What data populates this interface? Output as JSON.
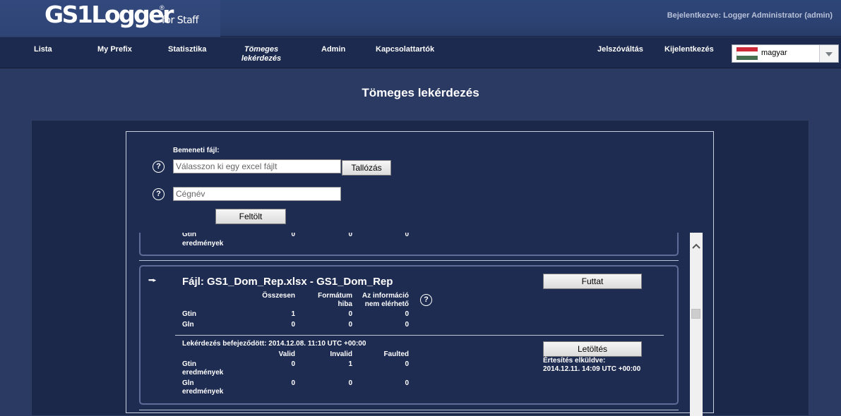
{
  "header": {
    "logo_main": "GS1Logger",
    "logo_reg": "®",
    "logo_sub": "for Staff",
    "logged_in": "Bejelentkezve: Logger Administrator (admin)"
  },
  "nav": {
    "items": [
      {
        "label": "Lista"
      },
      {
        "label": "My Prefix"
      },
      {
        "label": "Statisztika"
      },
      {
        "label": "Tömeges lekérdezés",
        "active": true
      },
      {
        "label": "Admin"
      },
      {
        "label": "Kapcsolattartók"
      }
    ],
    "right_items": [
      {
        "label": "Jelszóváltás"
      },
      {
        "label": "Kijelentkezés"
      }
    ],
    "language": {
      "selected": "magyar",
      "flag_colors": [
        "#ce2939",
        "#ffffff",
        "#477050"
      ]
    }
  },
  "page": {
    "title": "Tömeges lekérdezés"
  },
  "upload_form": {
    "input_label": "Bemeneti fájl:",
    "file_placeholder": "Válasszon ki egy excel fájlt",
    "browse_label": "Tallózás",
    "company_placeholder": "Cégnév",
    "upload_label": "Feltölt",
    "help_symbol": "?"
  },
  "prev_card": {
    "rows": [
      {
        "label_line1": "Gtin",
        "label_line2": "eredmények",
        "values": [
          "0",
          "0",
          "0"
        ]
      }
    ]
  },
  "job_card": {
    "title": "Fájl: GS1_Dom_Rep.xlsx - GS1_Dom_Rep",
    "run_label": "Futtat",
    "columns": [
      {
        "line1": "Összesen",
        "line2": ""
      },
      {
        "line1": "Formátum",
        "line2": "hiba"
      },
      {
        "line1": "Az információ",
        "line2": "nem elérhető"
      }
    ],
    "rows": [
      {
        "label": "Gtin",
        "values": [
          "1",
          "0",
          "0"
        ]
      },
      {
        "label": "Gln",
        "values": [
          "0",
          "0",
          "0"
        ]
      }
    ],
    "finished_text": "Lekérdezés befejeződött: 2014.12.08. 11:10 UTC +00:00",
    "download_label": "Letöltés",
    "notification_label": "Értesítés elküldve:",
    "notification_time": "2014.12.11. 14:09 UTC +00:00",
    "result_columns": [
      "Valid",
      "Invalid",
      "Faulted"
    ],
    "result_rows": [
      {
        "label_line1": "Gtin",
        "label_line2": "eredmények",
        "values": [
          "0",
          "1",
          "0"
        ]
      },
      {
        "label_line1": "Gln",
        "label_line2": "eredmények",
        "values": [
          "0",
          "0",
          "0"
        ]
      }
    ]
  }
}
